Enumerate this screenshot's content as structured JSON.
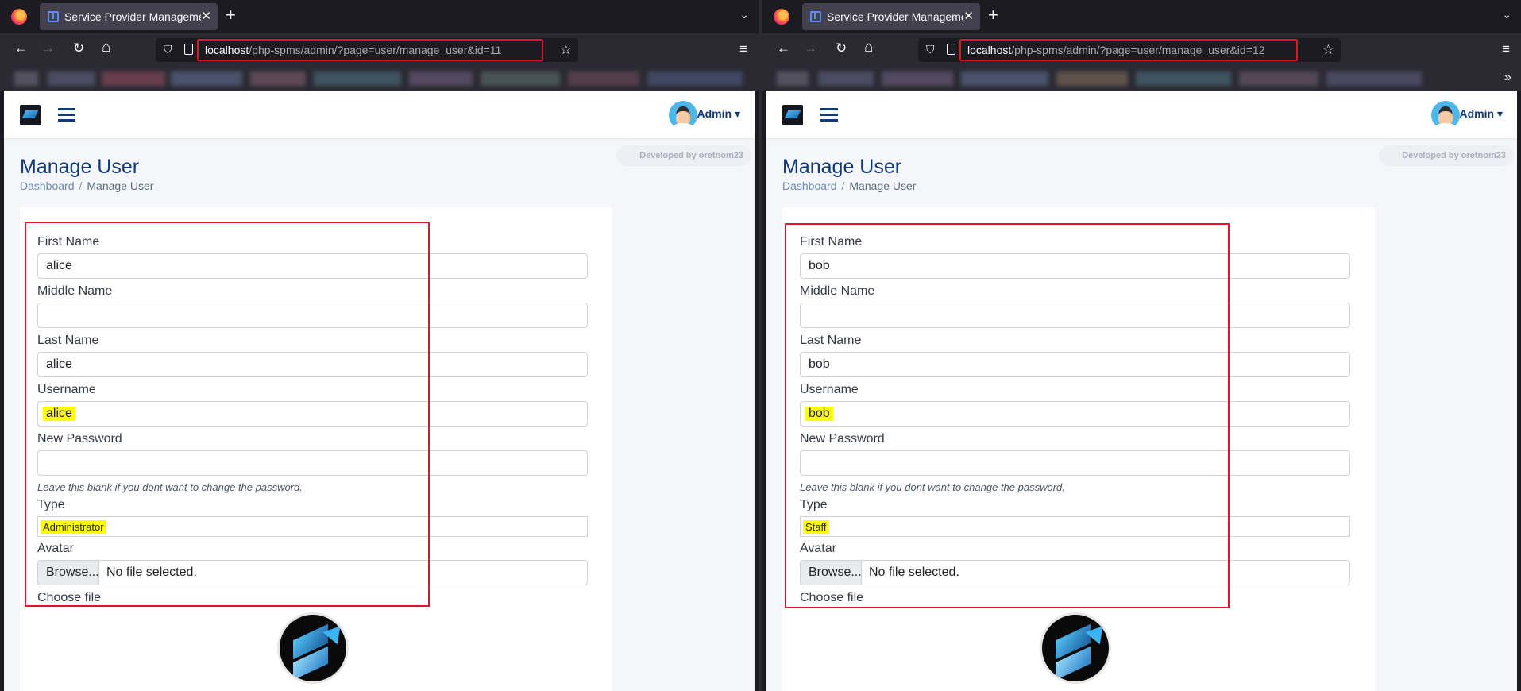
{
  "left": {
    "tab_title": "Service Provider Management System",
    "url_host": "localhost",
    "url_path": "/php-spms/admin/?page=user/manage_user&id=11",
    "admin_label": "Admin",
    "developed_by": "Developed by oretnom23",
    "page_title": "Manage User",
    "breadcrumb": [
      "Dashboard",
      "/",
      "Manage User"
    ],
    "form": {
      "first_name_label": "First Name",
      "first_name": "alice",
      "middle_name_label": "Middle Name",
      "middle_name": "",
      "last_name_label": "Last Name",
      "last_name": "alice",
      "username_label": "Username",
      "username": "alice",
      "password_label": "New Password",
      "password": "",
      "password_hint": "Leave this blank if you dont want to change the password.",
      "type_label": "Type",
      "type": "Administrator",
      "avatar_label": "Avatar",
      "browse_label": "Browse...",
      "file_status": "No file selected.",
      "choose_file": "Choose file"
    }
  },
  "right": {
    "tab_title": "Service Provider Management System",
    "url_host": "localhost",
    "url_path": "/php-spms/admin/?page=user/manage_user&id=12",
    "admin_label": "Admin",
    "developed_by": "Developed by oretnom23",
    "page_title": "Manage User",
    "breadcrumb": [
      "Dashboard",
      "/",
      "Manage User"
    ],
    "form": {
      "first_name_label": "First Name",
      "first_name": "bob",
      "middle_name_label": "Middle Name",
      "middle_name": "",
      "last_name_label": "Last Name",
      "last_name": "bob",
      "username_label": "Username",
      "username": "bob",
      "password_label": "New Password",
      "password": "",
      "password_hint": "Leave this blank if you dont want to change the password.",
      "type_label": "Type",
      "type": "Staff",
      "avatar_label": "Avatar",
      "browse_label": "Browse...",
      "file_status": "No file selected.",
      "choose_file": "Choose file"
    }
  },
  "icons": {
    "back": "←",
    "forward": "→",
    "reload": "↻",
    "home": "⌂",
    "shield": "⛉",
    "star": "☆",
    "menu": "≡",
    "close": "✕",
    "new_tab": "+",
    "tab_list": "⌄",
    "overflow": "»",
    "caret": "▾"
  },
  "colors": {
    "browser_bg": "#1c1b22",
    "toolbar_bg": "#2b2a33",
    "annotation_red": "#e0142a",
    "highlight_yellow": "#ffff00",
    "brand_navy": "#103a7a"
  }
}
